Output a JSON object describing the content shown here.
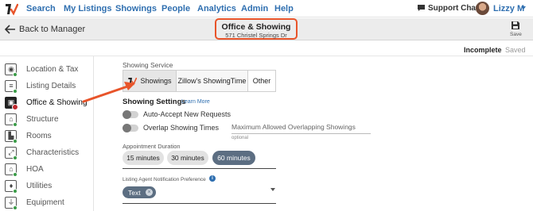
{
  "nav": {
    "links": [
      "Search",
      "My Listings",
      "Showings",
      "People",
      "Analytics",
      "Admin",
      "Help"
    ],
    "support": "Support Chat",
    "user": "Lizzy M"
  },
  "header": {
    "back": "Back to Manager",
    "title": "Office & Showing",
    "address": "571 Christel Springs Dr",
    "save": "Save"
  },
  "status": {
    "incomplete": "Incomplete",
    "saved": "Saved"
  },
  "sidebar": {
    "items": [
      {
        "label": "Location & Tax",
        "icon": "map-pin-icon",
        "glyph": "◉",
        "status": "complete"
      },
      {
        "label": "Listing Details",
        "icon": "list-icon",
        "glyph": "≡",
        "status": "complete"
      },
      {
        "label": "Office & Showing",
        "icon": "briefcase-icon",
        "glyph": "▣",
        "status": "alert"
      },
      {
        "label": "Structure",
        "icon": "house-icon",
        "glyph": "⌂",
        "status": "complete"
      },
      {
        "label": "Rooms",
        "icon": "door-icon",
        "glyph": "▙",
        "status": "complete"
      },
      {
        "label": "Characteristics",
        "icon": "expand-icon",
        "glyph": "⤢",
        "status": "complete"
      },
      {
        "label": "HOA",
        "icon": "building-icon",
        "glyph": "⌂",
        "status": "complete"
      },
      {
        "label": "Utilities",
        "icon": "drop-icon",
        "glyph": "♦",
        "status": "complete"
      },
      {
        "label": "Equipment",
        "icon": "plug-icon",
        "glyph": "⏚",
        "status": "complete"
      }
    ]
  },
  "showing": {
    "service_label": "Showing Service",
    "options": [
      "Showings",
      "Zillow's ShowingTime",
      "Other"
    ],
    "selected": "Showings",
    "settings_title": "Showing Settings",
    "learn_more": "Learn More",
    "auto_accept": "Auto-Accept New Requests",
    "overlap": "Overlap Showing Times",
    "max_overlap_label": "Maximum Allowed Overlapping Showings",
    "optional": "optional",
    "appt_label": "Appointment Duration",
    "durations": [
      "15 minutes",
      "30 minutes",
      "60 minutes"
    ],
    "duration_selected": "60 minutes",
    "notif_label": "Listing Agent Notification Preference",
    "notif_chip": "Text"
  },
  "colors": {
    "link": "#2f6fb0",
    "highlight": "#e8542a",
    "selected_pill": "#5c6e82",
    "complete": "#3a9b47",
    "alert": "#c0282d"
  }
}
